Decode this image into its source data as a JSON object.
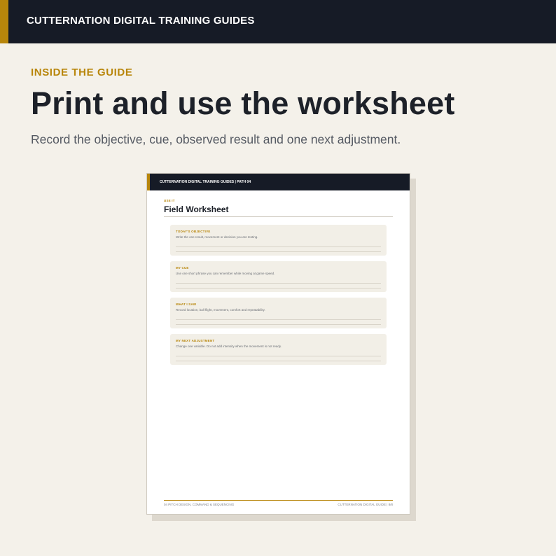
{
  "topbar": {
    "brand": "CUTTERNATION DIGITAL TRAINING GUIDES"
  },
  "hero": {
    "eyebrow": "INSIDE THE GUIDE",
    "headline": "Print and use the worksheet",
    "subline": "Record the objective, cue, observed result and one next adjustment."
  },
  "worksheet": {
    "header": "CUTTERNATION DIGITAL TRAINING GUIDES  |  PATH 04",
    "eyebrow": "USE IT",
    "title": "Field Worksheet",
    "cards": [
      {
        "label": "TODAY'S OBJECTIVE",
        "prompt": "Write the one result, movement or decision you are testing."
      },
      {
        "label": "MY CUE",
        "prompt": "Use one short phrase you can remember while moving at game speed."
      },
      {
        "label": "WHAT I SAW",
        "prompt": "Record location, ball flight, movement, comfort and repeatability."
      },
      {
        "label": "MY NEXT ADJUSTMENT",
        "prompt": "Change one variable. Do not add intensity when the movement is not ready."
      }
    ],
    "footer_left": "04  PITCH DESIGN, COMMAND & SEQUENCING",
    "footer_right": "CUTTERNATION DIGITAL GUIDE  |  8/8"
  },
  "colors": {
    "accent": "#b8860b",
    "dark": "#161b26",
    "background": "#f4f1ea"
  }
}
